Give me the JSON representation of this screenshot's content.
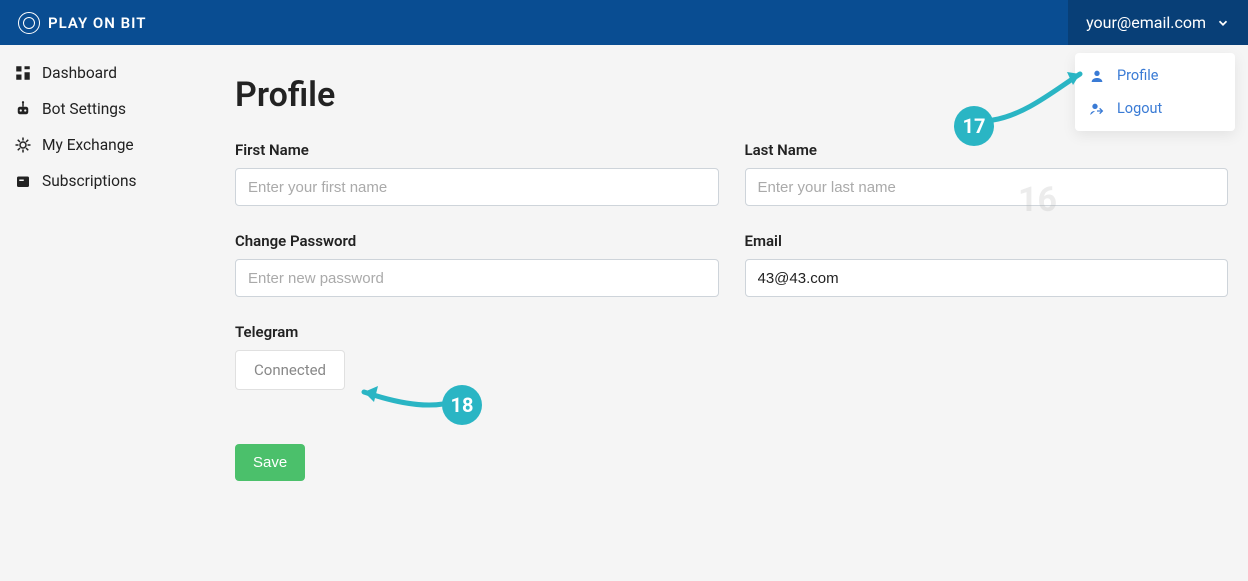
{
  "header": {
    "brand": "PLAY ON BIT",
    "user_email": "your@email.com"
  },
  "user_menu": {
    "profile": "Profile",
    "logout": "Logout"
  },
  "sidebar": {
    "items": [
      {
        "label": "Dashboard"
      },
      {
        "label": "Bot Settings"
      },
      {
        "label": "My Exchange"
      },
      {
        "label": "Subscriptions"
      }
    ]
  },
  "profile": {
    "title": "Profile",
    "first_name": {
      "label": "First Name",
      "placeholder": "Enter your first name",
      "value": ""
    },
    "last_name": {
      "label": "Last Name",
      "placeholder": "Enter your last name",
      "value": ""
    },
    "password": {
      "label": "Change Password",
      "placeholder": "Enter new password",
      "value": ""
    },
    "email": {
      "label": "Email",
      "value": "43@43.com"
    },
    "telegram": {
      "label": "Telegram",
      "status": "Connected"
    },
    "save": "Save"
  },
  "annotations": {
    "n16": "16",
    "n17": "17",
    "n18": "18"
  }
}
